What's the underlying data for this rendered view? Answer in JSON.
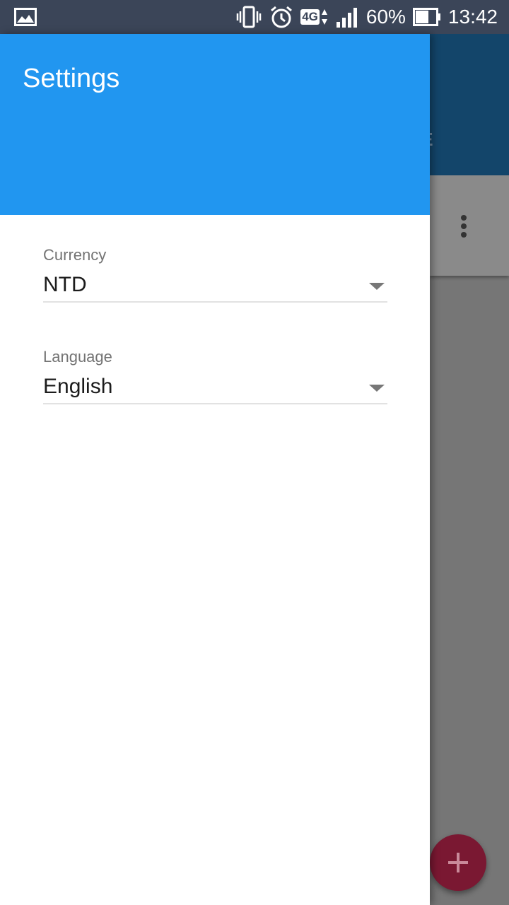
{
  "status_bar": {
    "battery_percent": "60%",
    "time": "13:42",
    "network": "4G",
    "icons": [
      "gallery-icon",
      "vibrate-icon",
      "alarm-icon",
      "network-4g-icon",
      "signal-icon",
      "battery-icon"
    ]
  },
  "background_app": {
    "tab_fragment": "GE"
  },
  "drawer": {
    "title": "Settings",
    "header_color": "#2196f0",
    "fields": [
      {
        "label": "Currency",
        "value": "NTD"
      },
      {
        "label": "Language",
        "value": "English"
      }
    ]
  },
  "colors": {
    "status_bar": "#3b4558",
    "fab": "#7a1832"
  }
}
